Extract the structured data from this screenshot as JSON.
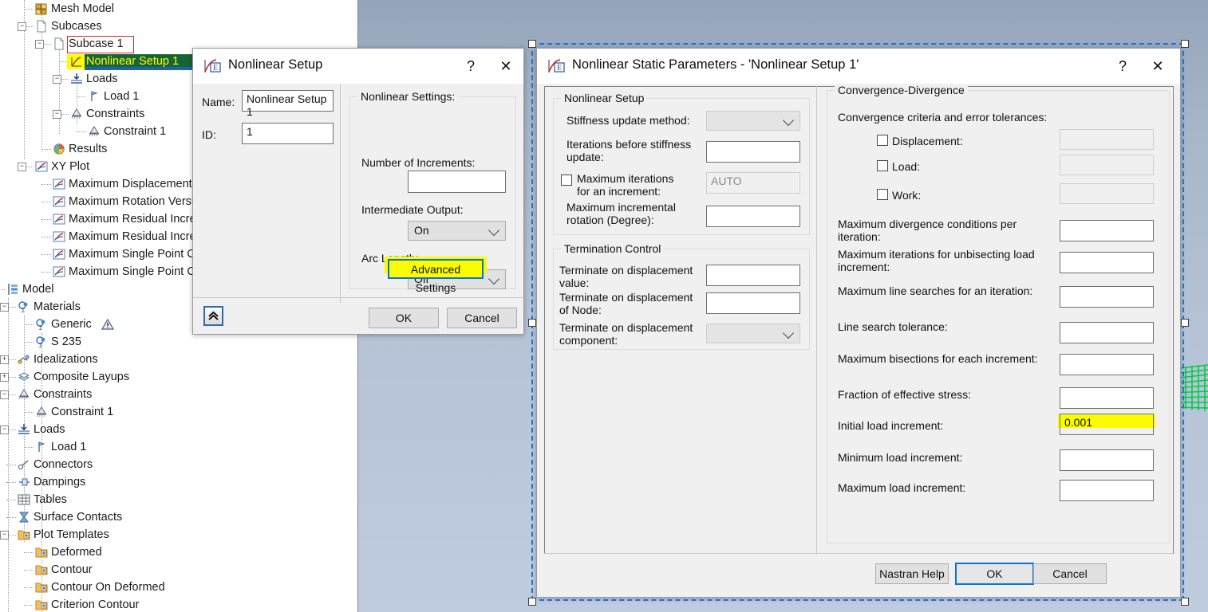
{
  "tree": {
    "items": [
      {
        "label": "Mesh Model",
        "icon": "mesh-model-icon",
        "indent": 44,
        "depth": 2
      },
      {
        "label": "Subcases",
        "icon": "document-icon",
        "indent": 44,
        "depth": 2
      },
      {
        "label": "Subcase 1",
        "icon": "document-icon",
        "indent": 66,
        "depth": 3
      },
      {
        "label": "Nonlinear Setup 1",
        "icon": "nonlinear-setup-icon",
        "indent": 88,
        "depth": 4
      },
      {
        "label": "Loads",
        "icon": "loads-icon",
        "indent": 88,
        "depth": 4
      },
      {
        "label": "Load 1",
        "icon": "load-icon",
        "indent": 110,
        "depth": 5
      },
      {
        "label": "Constraints",
        "icon": "constraints-icon",
        "indent": 88,
        "depth": 4
      },
      {
        "label": "Constraint 1",
        "icon": "constraint-icon",
        "indent": 110,
        "depth": 5
      },
      {
        "label": "Results",
        "icon": "results-icon",
        "indent": 66,
        "depth": 3
      },
      {
        "label": "XY Plot",
        "icon": "xy-plot-icon",
        "indent": 44,
        "depth": 2
      },
      {
        "label": "Maximum Displacement",
        "icon": "xy-plot-icon",
        "indent": 66,
        "depth": 3
      },
      {
        "label": "Maximum Rotation Versu",
        "icon": "xy-plot-icon",
        "indent": 66,
        "depth": 3
      },
      {
        "label": "Maximum Residual Incre",
        "icon": "xy-plot-icon",
        "indent": 66,
        "depth": 3
      },
      {
        "label": "Maximum Residual Incre",
        "icon": "xy-plot-icon",
        "indent": 66,
        "depth": 3
      },
      {
        "label": "Maximum Single Point C",
        "icon": "xy-plot-icon",
        "indent": 66,
        "depth": 3
      },
      {
        "label": "Maximum Single Point C",
        "icon": "xy-plot-icon",
        "indent": 66,
        "depth": 3
      },
      {
        "label": "Model",
        "icon": "model-icon",
        "indent": 8,
        "depth": 1
      },
      {
        "label": "Materials",
        "icon": "materials-icon",
        "indent": 22,
        "depth": 2
      },
      {
        "label": "Generic",
        "icon": "materials-icon",
        "indent": 44,
        "depth": 3,
        "warning": true
      },
      {
        "label": "S 235",
        "icon": "materials-icon",
        "indent": 44,
        "depth": 3
      },
      {
        "label": "Idealizations",
        "icon": "idealizations-icon",
        "indent": 22,
        "depth": 2
      },
      {
        "label": "Composite Layups",
        "icon": "composite-layups-icon",
        "indent": 22,
        "depth": 2
      },
      {
        "label": "Constraints",
        "icon": "constraints-icon",
        "indent": 22,
        "depth": 2
      },
      {
        "label": "Constraint 1",
        "icon": "constraint-icon",
        "indent": 44,
        "depth": 3
      },
      {
        "label": "Loads",
        "icon": "loads-icon",
        "indent": 22,
        "depth": 2
      },
      {
        "label": "Load 1",
        "icon": "load-icon",
        "indent": 44,
        "depth": 3
      },
      {
        "label": "Connectors",
        "icon": "connectors-icon",
        "indent": 22,
        "depth": 2
      },
      {
        "label": "Dampings",
        "icon": "dampings-icon",
        "indent": 22,
        "depth": 2
      },
      {
        "label": "Tables",
        "icon": "tables-icon",
        "indent": 22,
        "depth": 2
      },
      {
        "label": "Surface Contacts",
        "icon": "surface-contacts-icon",
        "indent": 22,
        "depth": 2
      },
      {
        "label": "Plot Templates",
        "icon": "folder-icon",
        "indent": 22,
        "depth": 2
      },
      {
        "label": "Deformed",
        "icon": "folder-icon",
        "indent": 44,
        "depth": 3
      },
      {
        "label": "Contour",
        "icon": "folder-icon",
        "indent": 44,
        "depth": 3
      },
      {
        "label": "Contour On Deformed",
        "icon": "folder-icon",
        "indent": 44,
        "depth": 3
      },
      {
        "label": "Criterion Contour",
        "icon": "folder-icon",
        "indent": 44,
        "depth": 3
      }
    ],
    "selected_outline_label": "Subcase 1",
    "highlighted_label": "Nonlinear Setup 1"
  },
  "nonlinear_setup_dialog": {
    "title": "Nonlinear Setup",
    "help_glyph": "?",
    "close_glyph": "✕",
    "name_label": "Name:",
    "name_value": "Nonlinear Setup 1",
    "id_label": "ID:",
    "id_value": "1",
    "group_caption": "Nonlinear Settings:",
    "increments_label": "Number of Increments:",
    "increments_value": "",
    "intermediate_output_label": "Intermediate Output:",
    "intermediate_output_value": "On",
    "arc_length_label": "Arc Length:",
    "arc_length_value": "Off",
    "advanced_settings_label": "Advanced Settings",
    "expand_glyph": "»",
    "ok_label": "OK",
    "cancel_label": "Cancel"
  },
  "nonlinear_static_parameters_dialog": {
    "title": "Nonlinear Static Parameters - 'Nonlinear Setup 1'",
    "help_glyph": "?",
    "close_glyph": "✕",
    "nonlinear_setup_group": {
      "caption": "Nonlinear Setup",
      "fields": [
        {
          "label": "Stiffness update method:",
          "type": "combo",
          "value": ""
        },
        {
          "label": "Iterations before stiffness\nupdate:",
          "type": "text",
          "value": ""
        },
        {
          "label": "Maximum iterations\nfor an increment:",
          "type": "text",
          "value": "",
          "checkbox": true,
          "checked": false,
          "readonly": true,
          "placeholder": "AUTO"
        },
        {
          "label": "Maximum incremental\nrotation (Degree):",
          "type": "text",
          "value": ""
        }
      ]
    },
    "termination_control_group": {
      "caption": "Termination Control",
      "fields": [
        {
          "label": "Terminate on displacement\nvalue:",
          "type": "text",
          "value": ""
        },
        {
          "label": "Terminate on displacement\nof Node:",
          "type": "text",
          "value": ""
        },
        {
          "label": "Terminate on displacement\ncomponent:",
          "type": "combo",
          "value": ""
        }
      ]
    },
    "convergence_group": {
      "caption": "Convergence-Divergence",
      "subcaption": "Convergence criteria and error tolerances:",
      "criteria": [
        {
          "label": "Displacement:",
          "checked": false,
          "value": "",
          "readonly": true
        },
        {
          "label": "Load:",
          "checked": false,
          "value": "",
          "readonly": true
        },
        {
          "label": "Work:",
          "checked": false,
          "value": "",
          "readonly": true
        }
      ],
      "fields": [
        {
          "label": "Maximum divergence conditions per iteration:",
          "value": ""
        },
        {
          "label": "Maximum iterations for unbisecting load\nincrement:",
          "value": ""
        },
        {
          "label": "Maximum line searches for an iteration:",
          "value": ""
        },
        {
          "label": "Line search tolerance:",
          "value": ""
        },
        {
          "label": "Maximum bisections for each increment:",
          "value": ""
        },
        {
          "label": "Fraction of effective stress:",
          "value": ""
        },
        {
          "label": "Initial load increment:",
          "value": "0.001",
          "highlighted": true
        },
        {
          "label": "Minimum load increment:",
          "value": ""
        },
        {
          "label": "Maximum load increment:",
          "value": ""
        }
      ]
    },
    "buttons": {
      "nastran_help": "Nastran Help",
      "ok": "OK",
      "cancel": "Cancel"
    }
  },
  "colors": {
    "highlight_yellow": "#ffff00",
    "selection_blue": "#1b74d8",
    "selection_red": "#d22b2b",
    "tree_select_green": "#166534",
    "mesh_green": "#00cc44",
    "viewport_bg": "#b4c2d6"
  }
}
